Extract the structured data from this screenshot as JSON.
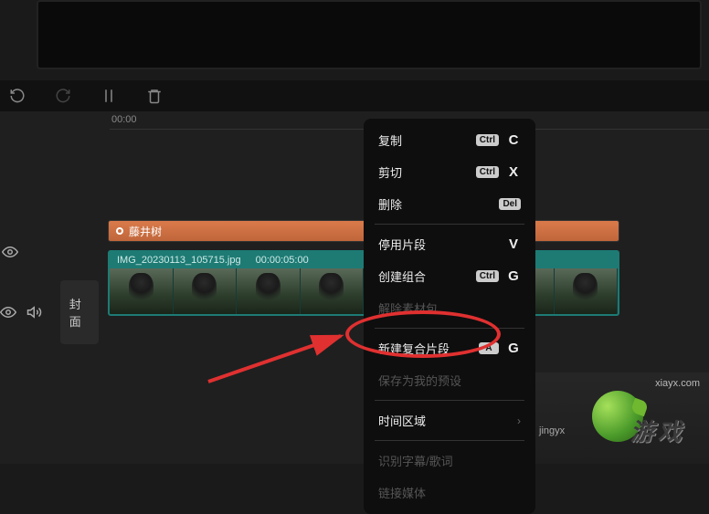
{
  "timeline": {
    "start_time": "00:00"
  },
  "text_clip": {
    "label": "藤井树"
  },
  "video_clip": {
    "filename": "IMG_20230113_105715.jpg",
    "duration": "00:00:05:00"
  },
  "track": {
    "cover_label": "封面"
  },
  "context_menu": {
    "items": [
      {
        "label": "复制",
        "badge": "Ctrl",
        "key": "C",
        "enabled": true
      },
      {
        "label": "剪切",
        "badge": "Ctrl",
        "key": "X",
        "enabled": true
      },
      {
        "label": "删除",
        "badge": "Del",
        "key": "",
        "enabled": true
      },
      {
        "sep": true
      },
      {
        "label": "停用片段",
        "badge": "",
        "key": "V",
        "enabled": true
      },
      {
        "label": "创建组合",
        "badge": "Ctrl",
        "key": "G",
        "enabled": true
      },
      {
        "label": "解除素材包",
        "badge": "",
        "key": "",
        "enabled": false
      },
      {
        "sep": true
      },
      {
        "label": "新建复合片段",
        "badge": "A",
        "key": "G",
        "enabled": true
      },
      {
        "label": "保存为我的预设",
        "badge": "",
        "key": "",
        "enabled": false
      },
      {
        "sep": true
      },
      {
        "label": "时间区域",
        "badge": "",
        "key": "",
        "enabled": true,
        "submenu": true
      },
      {
        "sep": true
      },
      {
        "label": "识别字幕/歌词",
        "badge": "",
        "key": "",
        "enabled": false
      },
      {
        "label": "链接媒体",
        "badge": "",
        "key": "",
        "enabled": false
      }
    ]
  },
  "watermark": {
    "url": "xiayx.com",
    "pinyin": "jingyx",
    "big_text": "游戏"
  }
}
